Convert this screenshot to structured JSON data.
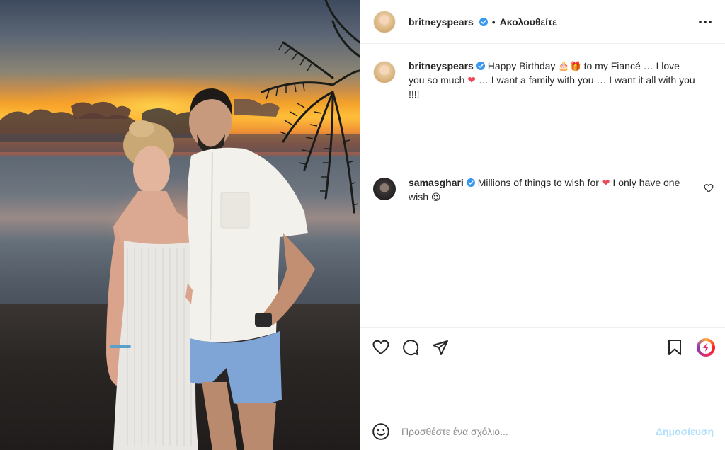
{
  "post": {
    "author": {
      "username": "britneyspears",
      "verified": true,
      "follow_label": "Ακολουθείτε",
      "separator": "•"
    },
    "caption": {
      "username": "britneyspears",
      "text_part1": "Happy Birthday ",
      "emoji1": "🎂🎁",
      "text_part2": " to my Fiancé … I love you so much ",
      "heart": "❤",
      "text_part3": " … I want a family with you … I want it all with you !!!!"
    },
    "comments": [
      {
        "username": "samasghari",
        "verified": true,
        "text_part1": "Millions of things to wish for ",
        "heart": "❤",
        "text_part2": " I only have one wish ",
        "emoji": "😍"
      }
    ],
    "actions": {
      "like_icon": "heart-outline-icon",
      "comment_icon": "comment-bubble-icon",
      "share_icon": "paper-plane-icon",
      "save_icon": "bookmark-icon",
      "boost_icon": "boost-ring-icon"
    },
    "comment_box": {
      "placeholder": "Προσθέστε ένα σχόλιο...",
      "post_label": "Δημοσίευση"
    }
  },
  "colors": {
    "verified_badge": "#3897f0",
    "heart": "#ed4956",
    "post_button_disabled": "#b2dffc",
    "divider": "#efefef"
  }
}
